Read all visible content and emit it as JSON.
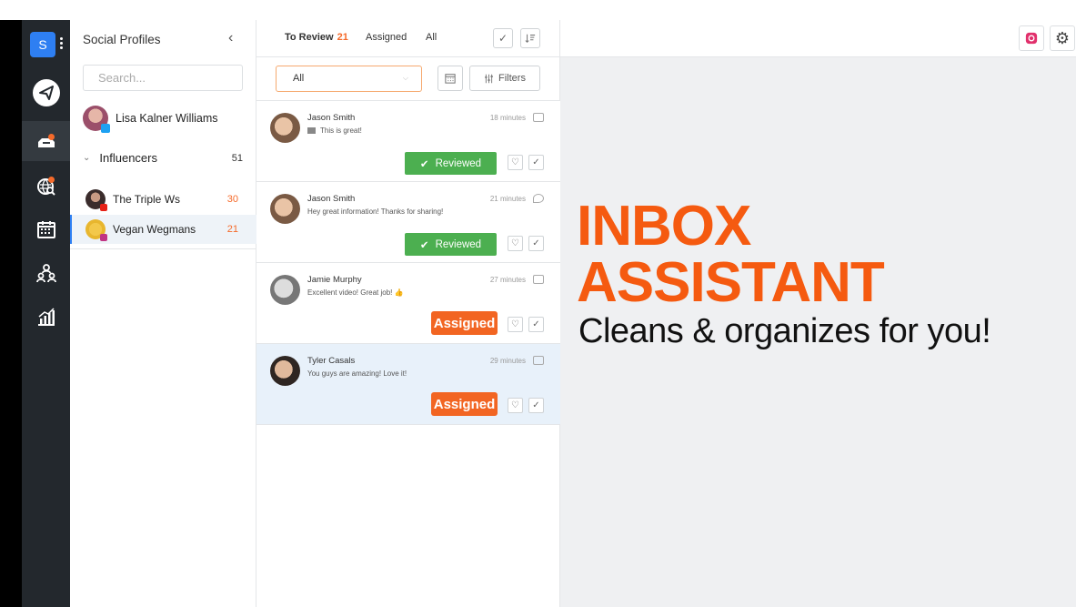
{
  "app": {
    "logo_letter": "S",
    "brand_color": "#2e7ff2",
    "accent_color": "#f56a2a"
  },
  "rail": {
    "items": [
      {
        "icon": "paper-plane-icon"
      },
      {
        "icon": "inbox-icon",
        "active": true,
        "notification": true
      },
      {
        "icon": "streams-search-icon",
        "notification": true
      },
      {
        "icon": "calendar-icon"
      },
      {
        "icon": "people-icon"
      },
      {
        "icon": "analytics-icon"
      }
    ]
  },
  "profiles": {
    "title": "Social Profiles",
    "search_placeholder": "Search...",
    "main_profile": {
      "name": "Lisa Kalner Williams",
      "network": "twitter"
    },
    "group": {
      "name": "Influencers",
      "count": "51"
    },
    "sub_profiles": [
      {
        "name": "The Triple Ws",
        "count": "30",
        "network": "youtube"
      },
      {
        "name": "Vegan Wegmans",
        "count": "21",
        "network": "instagram",
        "active": true
      }
    ]
  },
  "stream": {
    "tabs": [
      {
        "label": "To Review",
        "count": "21",
        "active": true
      },
      {
        "label": "Assigned"
      },
      {
        "label": "All"
      }
    ],
    "filter_select": "All",
    "filters_label": "Filters",
    "messages": [
      {
        "author": "Jason Smith",
        "text": "This is great!",
        "time": "18 minutes",
        "status": "Reviewed",
        "has_image_icon": true
      },
      {
        "author": "Jason Smith",
        "text": "Hey great information! Thanks for sharing!",
        "time": "21 minutes",
        "status": "Reviewed"
      },
      {
        "author": "Jamie Murphy",
        "text": "Excellent video! Great job! 👍",
        "time": "27 minutes",
        "status": "Assigned"
      },
      {
        "author": "Tyler Casals",
        "text": "You guys are amazing! Love it!",
        "time": "29 minutes",
        "status": "Assigned",
        "selected": true
      }
    ]
  },
  "promo": {
    "line1": "INBOX",
    "line2": "ASSISTANT",
    "line3": "Cleans & organizes for you!"
  }
}
